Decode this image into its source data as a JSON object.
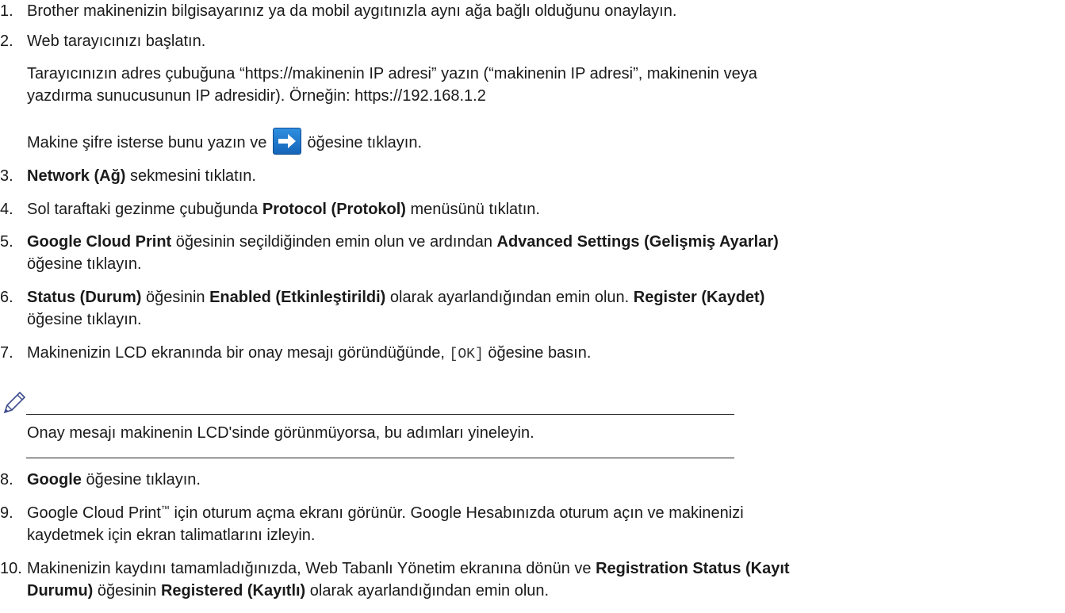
{
  "steps": [
    {
      "num": "1.",
      "text": "Brother makinenizin bilgisayarınız ya da mobil aygıtınızla aynı ağa bağlı olduğunu onaylayın."
    },
    {
      "num": "2.",
      "text": "Web tarayıcınızı başlatın.",
      "sub1": "Tarayıcınızın adres çubuğuna “https://makinenin IP adresi” yazın (“makinenin IP adresi”, makinenin veya",
      "sub1b": "yazdırma sunucusunun IP adresidir). Örneğin: https://192.168.1.2",
      "sub2_pre": "Makine şifre isterse bunu yazın ve",
      "sub2_post": "öğesine tıklayın."
    },
    {
      "num": "3.",
      "bold1": "Network (Ağ)",
      "text": " sekmesini tıklatın."
    },
    {
      "num": "4.",
      "pre": "Sol taraftaki gezinme çubuğunda ",
      "bold1": "Protocol (Protokol)",
      "text": " menüsünü tıklatın."
    },
    {
      "num": "5.",
      "bold1": "Google Cloud Print",
      "mid": " öğesinin seçildiğinden emin olun ve ardından ",
      "bold2": "Advanced Settings (Gelişmiş Ayarlar)",
      "line2": "öğesine tıklayın."
    },
    {
      "num": "6.",
      "bold1": "Status (Durum)",
      "mid": " öğesinin ",
      "bold2": "Enabled (Etkinleştirildi)",
      "mid2": " olarak ayarlandığından emin olun. ",
      "bold3": "Register (Kaydet)",
      "line2": "öğesine tıklayın."
    },
    {
      "num": "7.",
      "pre": "Makinenizin LCD ekranında bir onay mesajı göründüğünde, ",
      "mono": "[OK]",
      "text": " öğesine basın."
    },
    {
      "num": "8.",
      "bold1": "Google",
      "text": " öğesine tıklayın."
    },
    {
      "num": "9.",
      "pre": "Google Cloud Print",
      "tm": "™",
      "text": " için oturum açma ekranı görünür. Google Hesabınızda oturum açın ve makinenizi",
      "line2": "kaydetmek için ekran talimatlarını izleyin."
    },
    {
      "num": "10.",
      "pre": "Makinenizin kaydını tamamladığınızda, Web Tabanlı Yönetim ekranına dönün ve ",
      "bold1": "Registration Status (Kayıt",
      "bold2": "Durumu)",
      "mid": " öğesinin ",
      "bold3": "Registered (Kayıtlı)",
      "text": " olarak ayarlandığından emin olun."
    }
  ],
  "note": {
    "icon": "pencil-note-icon",
    "text": "Onay mesajı makinenin LCD'sinde görünmüyorsa, bu adımları yineleyin."
  },
  "icons": {
    "arrow_button": "right-arrow-icon",
    "arrow_color": "#1e7ad0"
  }
}
